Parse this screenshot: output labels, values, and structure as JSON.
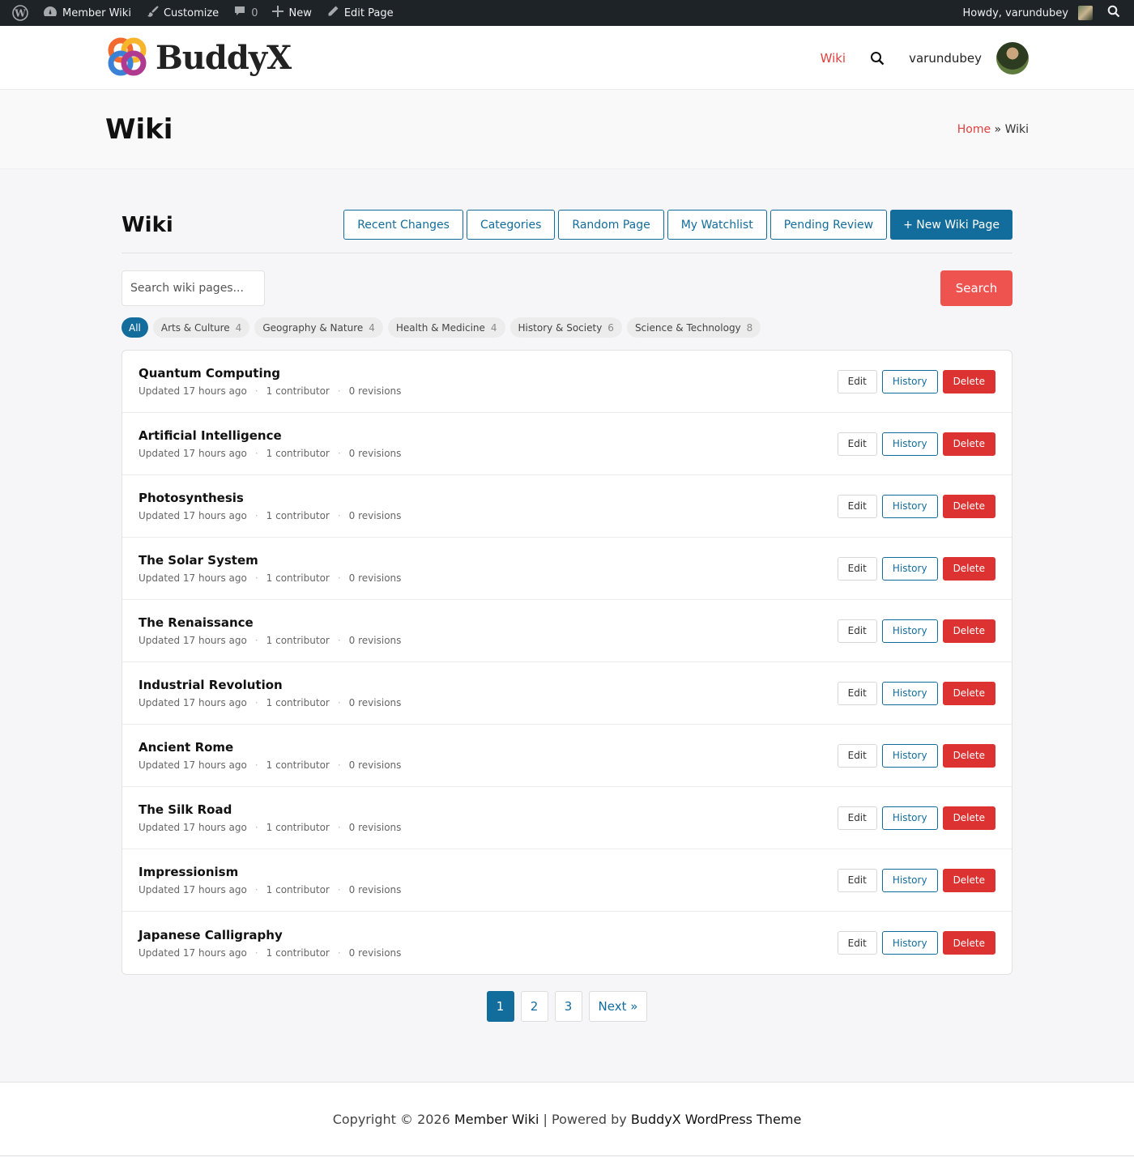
{
  "adminbar": {
    "site_name": "Member Wiki",
    "customize": "Customize",
    "comments_count": "0",
    "new": "New",
    "edit_page": "Edit Page",
    "howdy": "Howdy, varundubey"
  },
  "header": {
    "logo_text": "BuddyX",
    "nav_wiki": "Wiki",
    "username": "varundubey"
  },
  "page_title": {
    "title": "Wiki",
    "breadcrumb_home": "Home",
    "breadcrumb_sep": "»",
    "breadcrumb_current": "Wiki"
  },
  "wiki": {
    "heading": "Wiki",
    "actions": {
      "recent_changes": "Recent Changes",
      "categories": "Categories",
      "random_page": "Random Page",
      "my_watchlist": "My Watchlist",
      "pending_review": "Pending Review",
      "new_page": "+ New Wiki Page"
    },
    "search_placeholder": "Search wiki pages...",
    "search_button": "Search",
    "filters": [
      {
        "label": "All",
        "count": ""
      },
      {
        "label": "Arts & Culture",
        "count": "4"
      },
      {
        "label": "Geography & Nature",
        "count": "4"
      },
      {
        "label": "Health & Medicine",
        "count": "4"
      },
      {
        "label": "History & Society",
        "count": "6"
      },
      {
        "label": "Science & Technology",
        "count": "8"
      }
    ],
    "row_buttons": {
      "edit": "Edit",
      "history": "History",
      "delete": "Delete"
    },
    "pages": [
      {
        "title": "Quantum Computing",
        "updated": "Updated 17 hours ago",
        "contributors": "1 contributor",
        "revisions": "0 revisions"
      },
      {
        "title": "Artificial Intelligence",
        "updated": "Updated 17 hours ago",
        "contributors": "1 contributor",
        "revisions": "0 revisions"
      },
      {
        "title": "Photosynthesis",
        "updated": "Updated 17 hours ago",
        "contributors": "1 contributor",
        "revisions": "0 revisions"
      },
      {
        "title": "The Solar System",
        "updated": "Updated 17 hours ago",
        "contributors": "1 contributor",
        "revisions": "0 revisions"
      },
      {
        "title": "The Renaissance",
        "updated": "Updated 17 hours ago",
        "contributors": "1 contributor",
        "revisions": "0 revisions"
      },
      {
        "title": "Industrial Revolution",
        "updated": "Updated 17 hours ago",
        "contributors": "1 contributor",
        "revisions": "0 revisions"
      },
      {
        "title": "Ancient Rome",
        "updated": "Updated 17 hours ago",
        "contributors": "1 contributor",
        "revisions": "0 revisions"
      },
      {
        "title": "The Silk Road",
        "updated": "Updated 17 hours ago",
        "contributors": "1 contributor",
        "revisions": "0 revisions"
      },
      {
        "title": "Impressionism",
        "updated": "Updated 17 hours ago",
        "contributors": "1 contributor",
        "revisions": "0 revisions"
      },
      {
        "title": "Japanese Calligraphy",
        "updated": "Updated 17 hours ago",
        "contributors": "1 contributor",
        "revisions": "0 revisions"
      }
    ],
    "pagination": [
      "1",
      "2",
      "3"
    ],
    "pagination_next": "Next »"
  },
  "footer": {
    "prefix": "Copyright © 2026",
    "site": "Member Wiki",
    "middle": "| Powered by",
    "theme": "BuddyX WordPress Theme"
  },
  "colors": {
    "accent": "#136d9c",
    "brand_red": "#e0413e",
    "danger": "#dc3232",
    "search_button": "#ef5350"
  }
}
